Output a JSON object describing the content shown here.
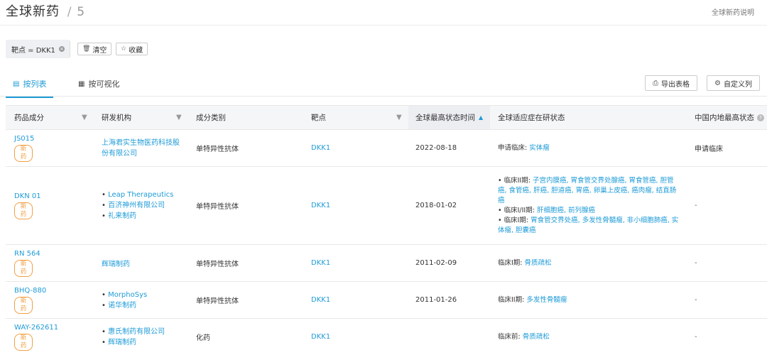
{
  "header": {
    "title": "全球新药",
    "separator": "/",
    "count": "5",
    "help_link": "全球新药说明"
  },
  "filter": {
    "chip_label": "靶点 = DKK1",
    "chip_close": "×",
    "clear_label": "清空",
    "favorite_label": "收藏"
  },
  "tabs": [
    {
      "label": "按列表",
      "active": true
    },
    {
      "label": "按可视化",
      "active": false
    }
  ],
  "actions": {
    "export_label": "导出表格",
    "custom_columns_label": "自定义列"
  },
  "table": {
    "columns": [
      "药品成分",
      "研发机构",
      "成分类别",
      "靶点",
      "全球最高状态时间",
      "全球适应症在研状态",
      "中国内地最高状态"
    ],
    "rows": [
      {
        "drug": "JS015",
        "badge": "新药",
        "orgs": [
          "上海君实生物医药科技股份有限公司"
        ],
        "category": "单特异性抗体",
        "target": "DKK1",
        "date": "2022-08-18",
        "status": [
          {
            "phase": "申请临床:",
            "indications": "实体瘤"
          }
        ],
        "china_status": "申请临床"
      },
      {
        "drug": "DKN 01",
        "badge": "新药",
        "orgs": [
          "Leap Therapeutics",
          "百济神州有限公司",
          "礼来制药"
        ],
        "category": "单特异性抗体",
        "target": "DKK1",
        "date": "2018-01-02",
        "status": [
          {
            "phase": "临床II期:",
            "indications": "子宫内膜癌, 胃食管交界处腺癌, 胃食管癌, 胆管癌, 食管癌, 肝癌, 胆道癌, 胃癌, 卵巢上皮癌, 癌肉瘤, 结直肠癌"
          },
          {
            "phase": "临床I/II期:",
            "indications": "肝细胞癌, 前列腺癌"
          },
          {
            "phase": "临床I期:",
            "indications": "胃食管交界处癌, 多发性骨髓瘤, 非小细胞肺癌, 实体瘤, 胆囊癌"
          }
        ],
        "china_status": "-"
      },
      {
        "drug": "RN 564",
        "badge": "新药",
        "orgs": [
          "辉瑞制药"
        ],
        "category": "单特异性抗体",
        "target": "DKK1",
        "date": "2011-02-09",
        "status": [
          {
            "phase": "临床I期:",
            "indications": "骨质疏松"
          }
        ],
        "china_status": "-"
      },
      {
        "drug": "BHQ-880",
        "badge": "新药",
        "orgs": [
          "MorphoSys",
          "诺华制药"
        ],
        "category": "单特异性抗体",
        "target": "DKK1",
        "date": "2011-01-26",
        "status": [
          {
            "phase": "临床II期:",
            "indications": "多发性骨髓瘤"
          }
        ],
        "china_status": "-"
      },
      {
        "drug": "WAY-262611",
        "badge": "新药",
        "orgs": [
          "惠氏制药有限公司",
          "辉瑞制药"
        ],
        "category": "化药",
        "target": "DKK1",
        "date": "",
        "status": [
          {
            "phase": "临床前:",
            "indications": "骨质疏松"
          }
        ],
        "china_status": "-"
      }
    ]
  },
  "icons": {
    "filter": "funnel-icon",
    "sort": "sort-icon",
    "info": "info-icon",
    "trash": "trash-icon",
    "star": "star-icon",
    "list": "list-icon",
    "grid": "grid-icon",
    "export": "export-icon",
    "settings": "settings-icon"
  },
  "colors": {
    "link": "#1e9bd7",
    "badge": "#f0a044",
    "header_bg": "#f5f6f8"
  }
}
